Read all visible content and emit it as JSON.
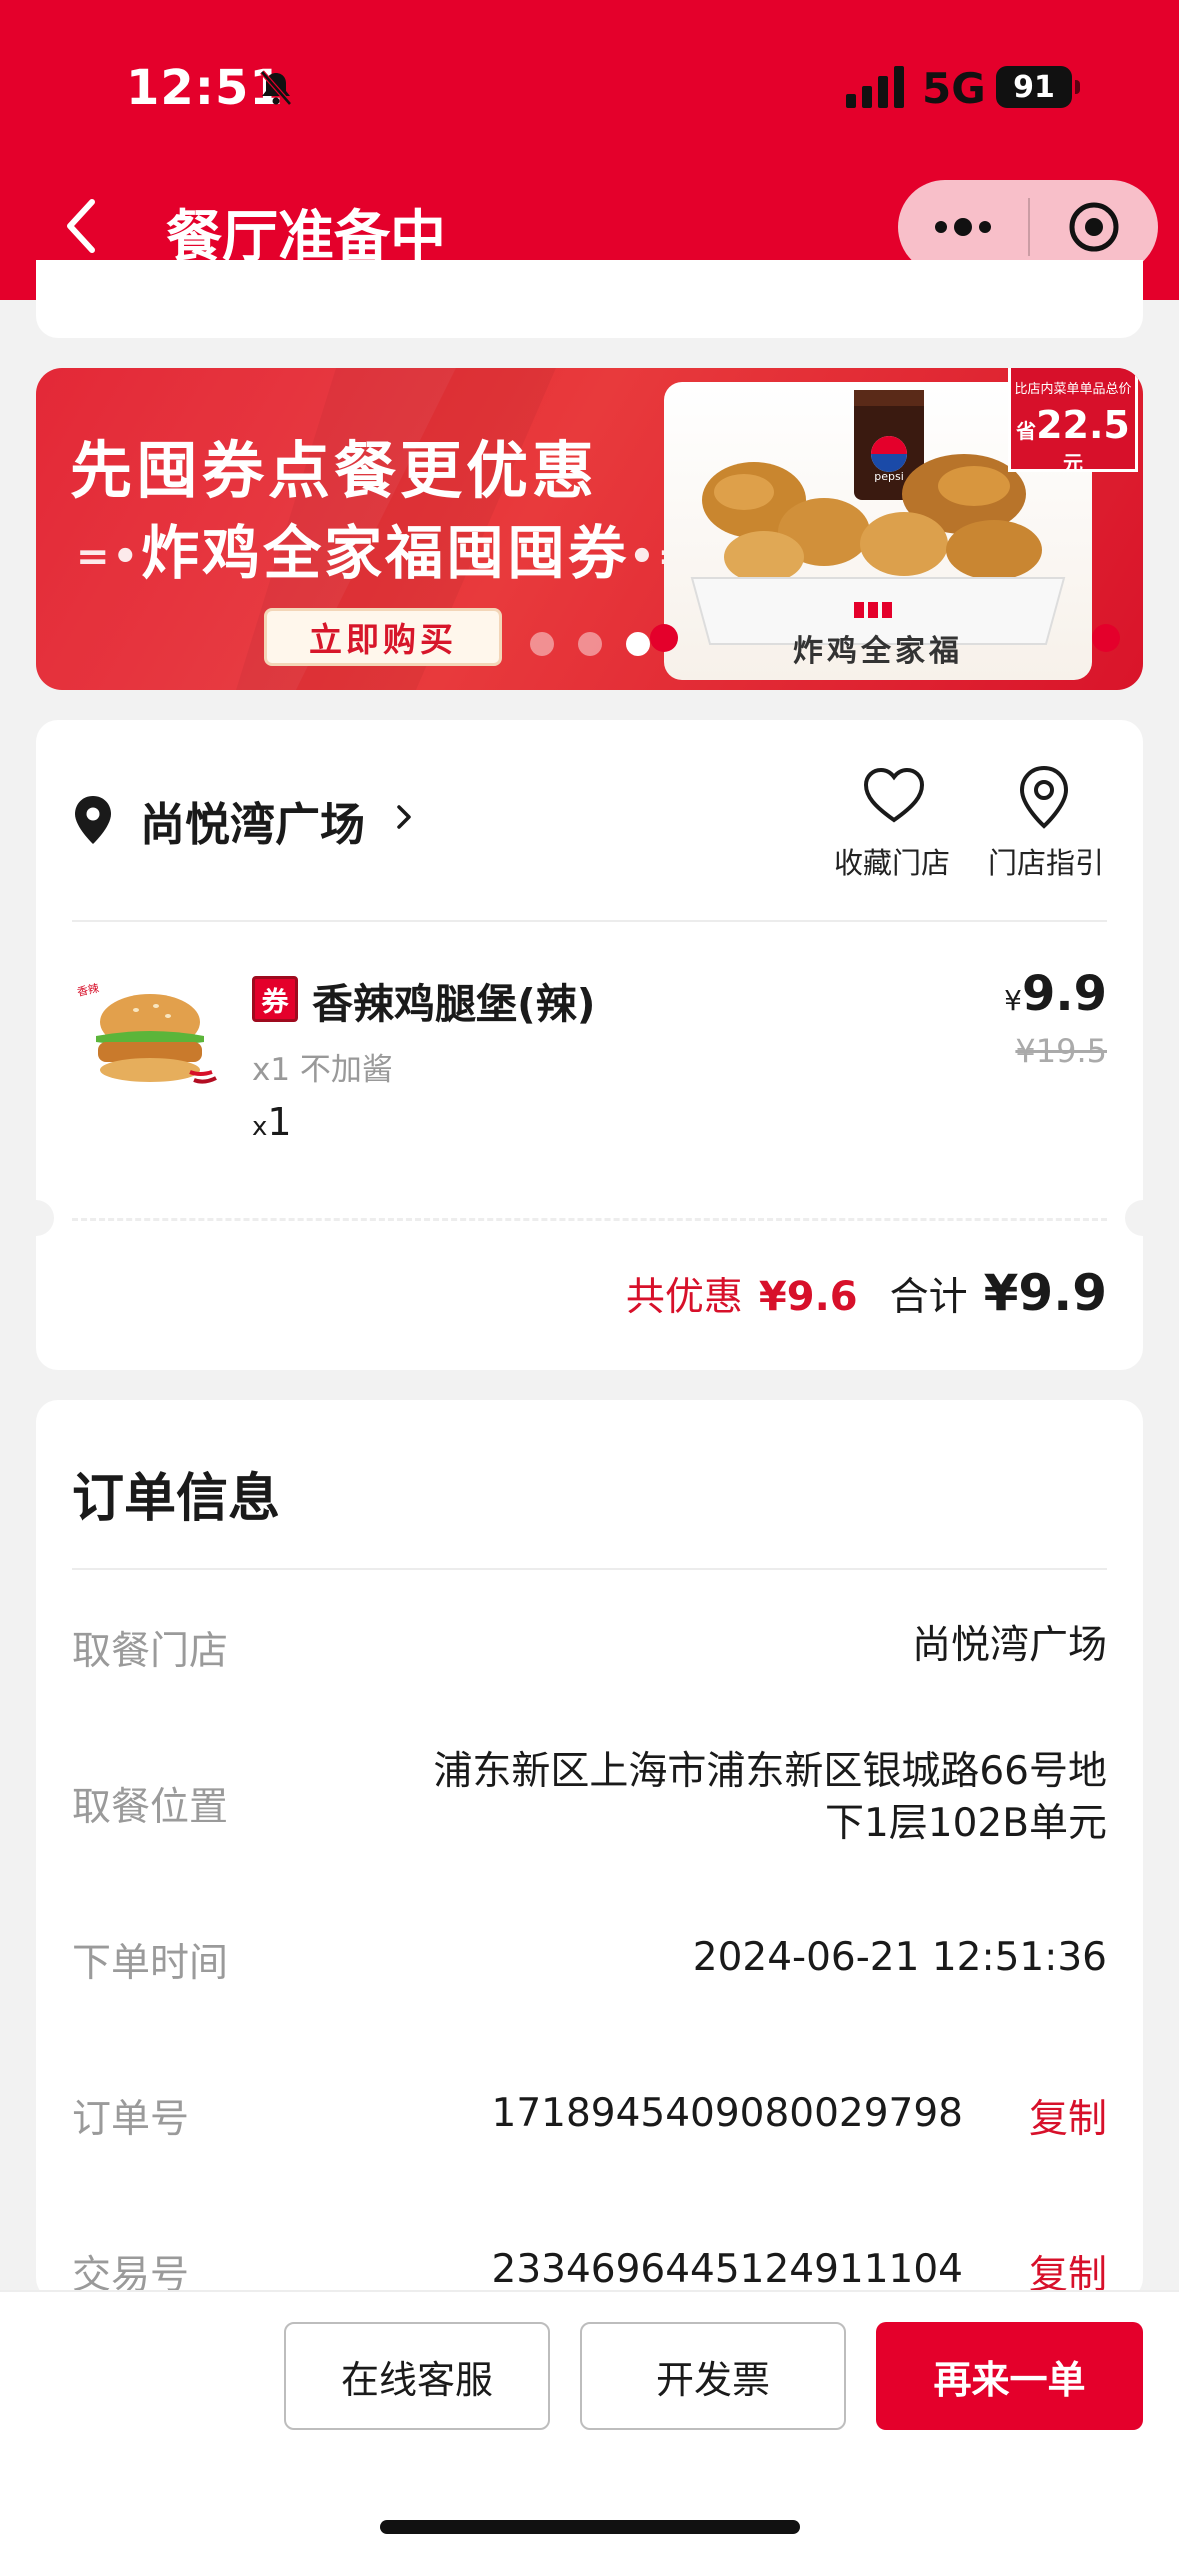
{
  "status_bar": {
    "time": "12:51",
    "network": "5G",
    "battery": "91"
  },
  "nav": {
    "title": "餐厅准备中"
  },
  "banner": {
    "line1": "先囤券点餐更优惠",
    "line2": "炸鸡全家福囤囤券",
    "button_label": "立即购买",
    "tag_small": "比店内菜单单品总价",
    "tag_prefix": "省",
    "tag_amount": "22.5",
    "tag_unit": "元",
    "product_caption": "炸鸡全家福",
    "cup_brand": "pepsi",
    "slide_count": 3,
    "active_slide": 3
  },
  "store": {
    "name": "尚悦湾广场",
    "favorite_label": "收藏门店",
    "guide_label": "门店指引"
  },
  "item": {
    "badge": "券",
    "name": "香辣鸡腿堡(辣)",
    "spec": "x1 不加酱",
    "qty_prefix": "x",
    "qty": "1",
    "price_symbol": "¥",
    "price": "9.9",
    "original_price": "¥19.5"
  },
  "summary": {
    "discount_label": "共优惠",
    "discount_value": "¥9.6",
    "total_label": "合计",
    "total_value": "¥9.9"
  },
  "order_info": {
    "title": "订单信息",
    "pickup_store_label": "取餐门店",
    "pickup_store_value": "尚悦湾广场",
    "pickup_location_label": "取餐位置",
    "pickup_location_line1": "浦东新区上海市浦东新区银城路66号地",
    "pickup_location_line2": "下1层102B单元",
    "order_time_label": "下单时间",
    "order_time_value": "2024-06-21 12:51:36",
    "order_no_label": "订单号",
    "order_no_value": "1718945409080029798",
    "trade_no_label": "交易号",
    "trade_no_value": "2334696445124911104",
    "copy_label": "复制"
  },
  "actions": {
    "service_label": "在线客服",
    "invoice_label": "开发票",
    "reorder_label": "再来一单"
  },
  "colors": {
    "brand_red": "#e4002b",
    "discount_red": "#d7102a",
    "background": "#f2f2f2"
  }
}
